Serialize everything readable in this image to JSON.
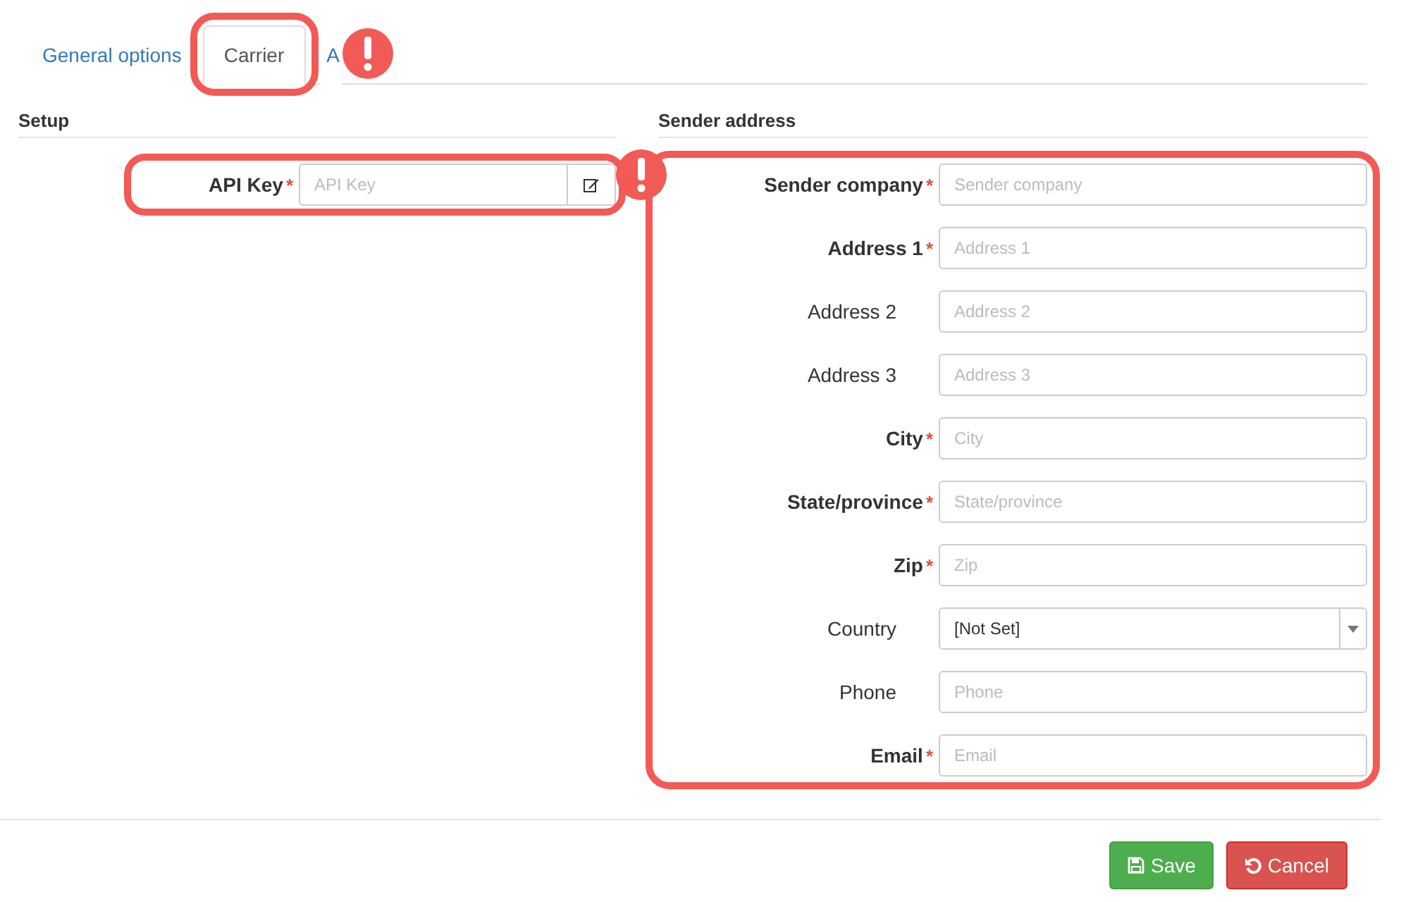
{
  "tabs": [
    {
      "label": "General options",
      "selected": false,
      "flagged": false
    },
    {
      "label": "Carrier",
      "selected": true,
      "flagged": true
    },
    {
      "label": "A",
      "selected": false,
      "flagged": false
    }
  ],
  "setup": {
    "title": "Setup",
    "flagged": true,
    "fields": [
      {
        "label": "API Key",
        "required_mark": "*",
        "placeholder": "API Key",
        "kind": "button-input"
      }
    ]
  },
  "sender_address": {
    "title": "Sender address",
    "flagged": true,
    "fields": [
      {
        "label": "Sender company",
        "required_mark": "*",
        "placeholder": "Sender company",
        "kind": "text"
      },
      {
        "label": "Address 1",
        "required_mark": "*",
        "placeholder": "Address 1",
        "kind": "text"
      },
      {
        "label": "Address 2",
        "placeholder": "Address 2",
        "kind": "text"
      },
      {
        "label": "Address 3",
        "placeholder": "Address 3",
        "kind": "text"
      },
      {
        "label": "City",
        "required_mark": "*",
        "placeholder": "City",
        "kind": "text"
      },
      {
        "label": "State/province",
        "required_mark": "*",
        "placeholder": "State/province",
        "kind": "text"
      },
      {
        "label": "Zip",
        "required_mark": "*",
        "placeholder": "Zip",
        "kind": "text"
      },
      {
        "label": "Country",
        "value": "[Not Set]",
        "kind": "select"
      },
      {
        "label": "Phone",
        "placeholder": "Phone",
        "kind": "text"
      },
      {
        "label": "Email",
        "required_mark": "*",
        "placeholder": "Email",
        "kind": "text"
      }
    ]
  },
  "buttons": [
    {
      "label": "Save",
      "kind": "save"
    },
    {
      "label": "Cancel",
      "kind": "cancel"
    }
  ]
}
